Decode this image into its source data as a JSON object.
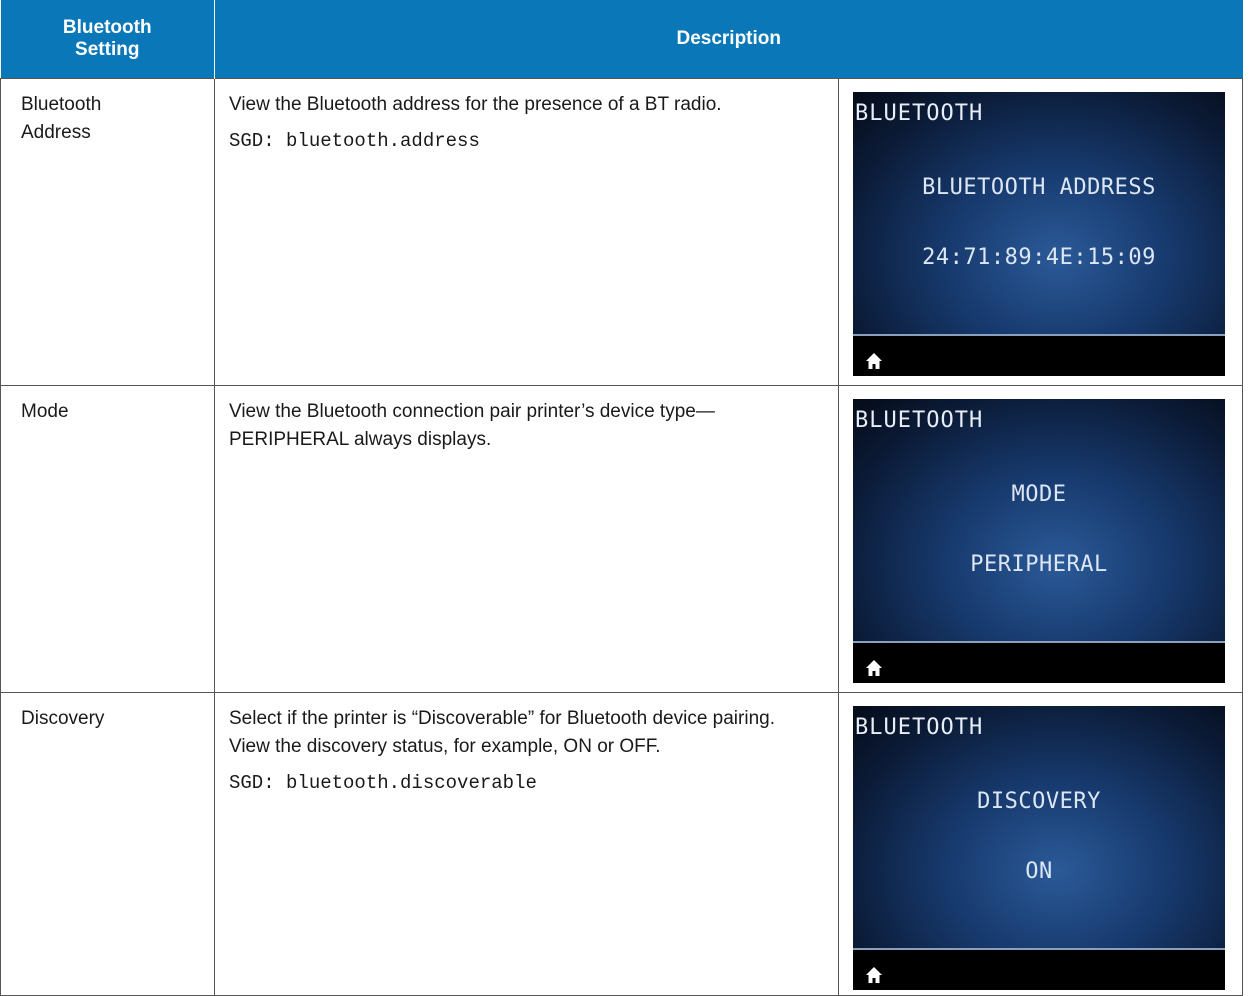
{
  "table": {
    "headers": [
      "Bluetooth Setting",
      "Description"
    ],
    "rows": [
      {
        "name": "Bluetooth Address",
        "description": "View the Bluetooth address for the presence of a BT radio.",
        "sgd": "SGD: bluetooth.address",
        "screen": {
          "title": "BLUETOOTH",
          "line1": "BLUETOOTH ADDRESS",
          "line2": "24:71:89:4E:15:09",
          "icon": "home-icon"
        }
      },
      {
        "name": "Mode",
        "description": "View the Bluetooth connection pair printer’s device type—PERIPHERAL always displays.",
        "sgd": "",
        "screen": {
          "title": "BLUETOOTH",
          "line1": "MODE",
          "line2": "PERIPHERAL",
          "icon": "home-icon"
        }
      },
      {
        "name": "Discovery",
        "description": "Select if the printer is “Discoverable” for Bluetooth device pairing. View the discovery status, for example, ON or OFF.",
        "sgd": "SGD: bluetooth.discoverable",
        "screen": {
          "title": "BLUETOOTH",
          "line1": "DISCOVERY",
          "line2": "ON",
          "icon": "home-icon"
        }
      }
    ]
  },
  "colors": {
    "header_bg": "#0a78b8",
    "header_text": "#ffffff",
    "screen_bg": "#173a6e"
  }
}
